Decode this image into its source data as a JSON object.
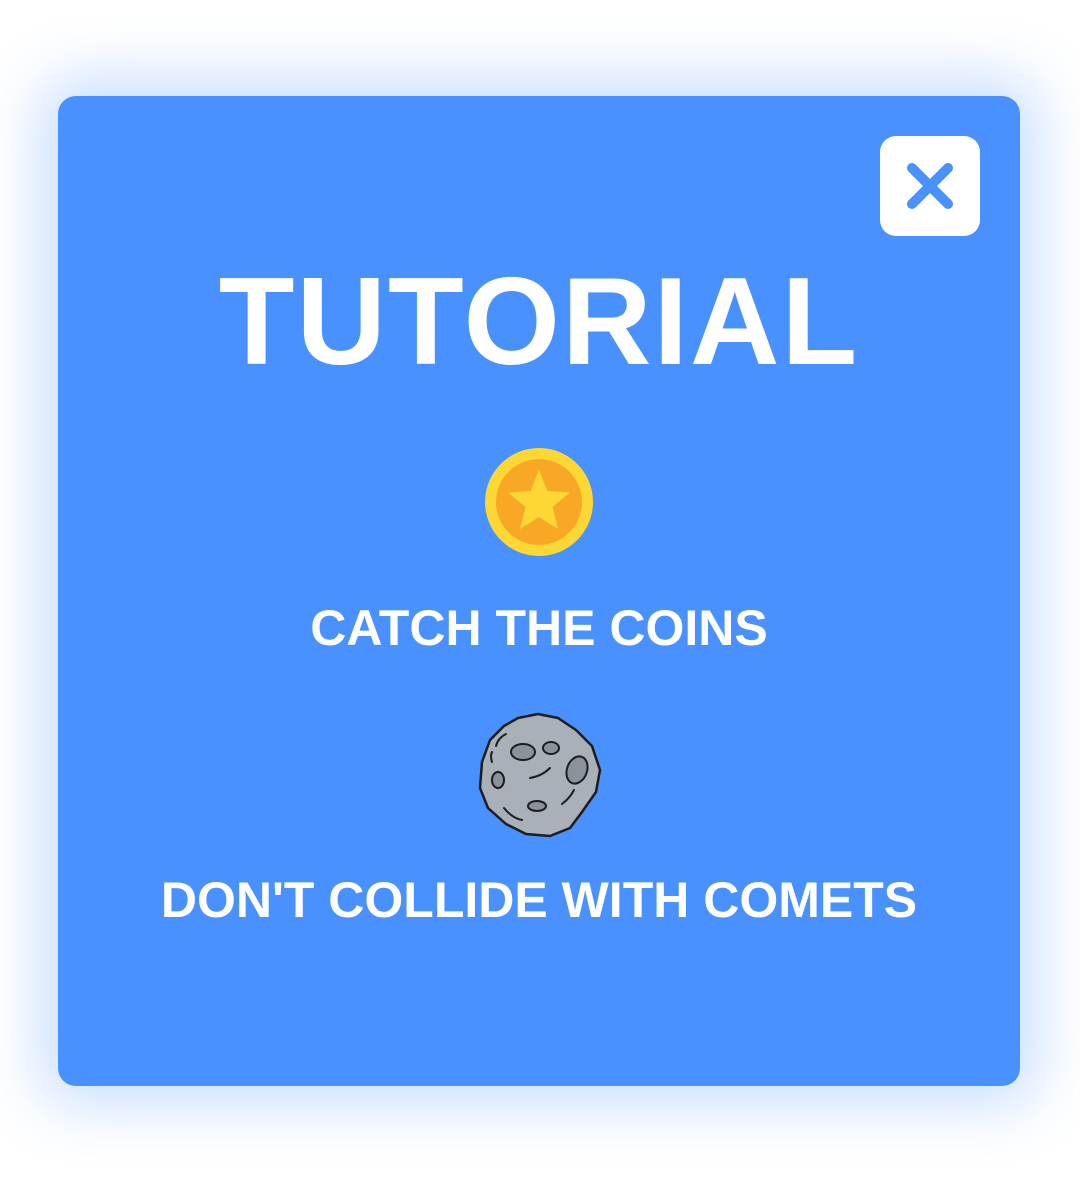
{
  "tutorial": {
    "title": "TUTORIAL",
    "close_icon": "close-icon",
    "steps": [
      {
        "icon": "coin-icon",
        "text": "CATCH THE COINS"
      },
      {
        "icon": "comet-icon",
        "text": "DON'T COLLIDE WITH COMETS"
      }
    ]
  },
  "colors": {
    "panel": "#4891fe",
    "text": "#ffffff",
    "close_button_bg": "#ffffff",
    "close_icon": "#4891fe",
    "coin_outer": "#fdd835",
    "coin_inner": "#f9a825",
    "comet_fill": "#a9b0b7",
    "comet_stroke": "#1d1d1d"
  }
}
